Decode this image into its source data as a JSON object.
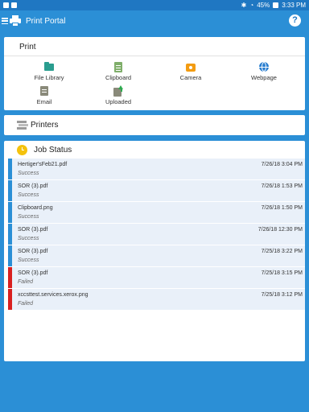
{
  "statusbar": {
    "battery": "45%",
    "time": "3:33 PM"
  },
  "app": {
    "title": "Print Portal"
  },
  "print_section": {
    "title": "Print",
    "tiles": [
      {
        "label": "File Library",
        "icon": "folder-icon"
      },
      {
        "label": "Clipboard",
        "icon": "clipboard-icon"
      },
      {
        "label": "Camera",
        "icon": "camera-icon"
      },
      {
        "label": "Webpage",
        "icon": "globe-icon"
      },
      {
        "label": "Email",
        "icon": "email-icon"
      },
      {
        "label": "Uploaded",
        "icon": "upload-icon"
      }
    ]
  },
  "printers": {
    "label": "Printers"
  },
  "job_status": {
    "title": "Job Status",
    "jobs": [
      {
        "name": "Hertiger'sFeb21.pdf",
        "status": "Success",
        "time": "7/26/18 3:04 PM"
      },
      {
        "name": "SOR (3).pdf",
        "status": "Success",
        "time": "7/26/18 1:53 PM"
      },
      {
        "name": "Clipboard.png",
        "status": "Success",
        "time": "7/26/18 1:50 PM"
      },
      {
        "name": "SOR (3).pdf",
        "status": "Success",
        "time": "7/26/18 12:30 PM"
      },
      {
        "name": "SOR (3).pdf",
        "status": "Success",
        "time": "7/25/18 3:22 PM"
      },
      {
        "name": "SOR (3).pdf",
        "status": "Failed",
        "time": "7/25/18 3:15 PM"
      },
      {
        "name": "xccsttest.services.xerox.png",
        "status": "Failed",
        "time": "7/25/18 3:12 PM"
      }
    ]
  },
  "colors": {
    "primary": "#2b8fd6",
    "success_bar": "#2b8fd6",
    "failed_bar": "#d92020",
    "row_bg": "#e9f0f9"
  }
}
